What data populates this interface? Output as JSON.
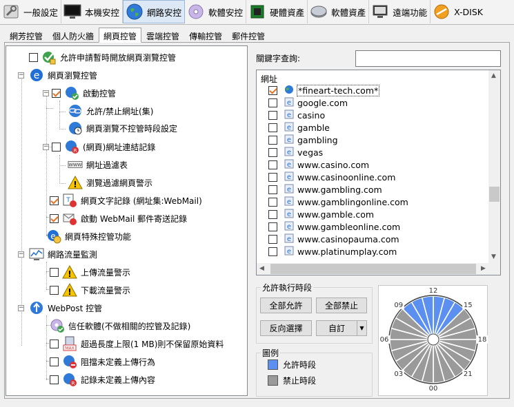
{
  "toolbar": [
    {
      "label": "一般設定",
      "icon": "wrench-icon"
    },
    {
      "label": "本機安控",
      "icon": "monitor-icon"
    },
    {
      "label": "網路安控",
      "icon": "globe-icon"
    },
    {
      "label": "軟體安控",
      "icon": "cd-icon"
    },
    {
      "label": "硬體資產",
      "icon": "chip-icon"
    },
    {
      "label": "軟體資產",
      "icon": "disc-icon"
    },
    {
      "label": "遠端功能",
      "icon": "remote-monitor-icon"
    },
    {
      "label": "X-DISK",
      "icon": "x-disk-icon"
    }
  ],
  "subtabs": [
    "網芳控管",
    "個人防火牆",
    "網頁控管",
    "雲端控管",
    "傳輸控管",
    "郵件控管"
  ],
  "tree": {
    "allow_request": "允許申請暫時開放網頁瀏覽控管",
    "web_browse": "網頁瀏覽控管",
    "enable_control": "啟動控管",
    "allow_block_urls": "允許/禁止網址(集)",
    "no_control_period": "網頁瀏覽不控管時段設定",
    "url_link_log": "(網頁)網址連結記錄",
    "url_filter_table": "網址過濾表",
    "filter_warning": "瀏覽過濾網頁警示",
    "text_log": "網頁文字記錄 (網址集:WebMail)",
    "webmail_log": "啟動 WebMail 郵件寄送記錄",
    "special_control": "網頁特殊控管功能",
    "traffic_monitor": "網路流量監測",
    "upload_warning": "上傳流量警示",
    "download_warning": "下載流量警示",
    "webpost": "WebPost 控管",
    "trusted_software": "信任軟體(不做相關的控管及記錄)",
    "size_limit": "超過長度上限(1 MB)則不保留原始資料",
    "block_undefined": "阻擋未定義上傳行為",
    "log_undefined": "記錄未定義上傳內容",
    "size_badge": "MAX"
  },
  "keyword": {
    "label": "關鍵字查詢:",
    "value": ""
  },
  "url_list": {
    "header": "網址",
    "items": [
      {
        "text": "*fineart-tech.com*",
        "checked": true,
        "selected": true
      },
      {
        "text": "google.com",
        "checked": false
      },
      {
        "text": "casino",
        "checked": false
      },
      {
        "text": "gamble",
        "checked": false
      },
      {
        "text": "gambling",
        "checked": false
      },
      {
        "text": "vegas",
        "checked": false
      },
      {
        "text": "www.casino.com",
        "checked": false
      },
      {
        "text": "www.casinoonline.com",
        "checked": false
      },
      {
        "text": "www.gambling.com",
        "checked": false
      },
      {
        "text": "www.gamblingonline.com",
        "checked": false
      },
      {
        "text": "www.gamble.com",
        "checked": false
      },
      {
        "text": "www.gambleonline.com",
        "checked": false
      },
      {
        "text": "www.casinopauma.com",
        "checked": false
      },
      {
        "text": "www.platinumplay.com",
        "checked": false
      }
    ]
  },
  "period": {
    "title": "允許執行時段",
    "allow_all": "全部允許",
    "deny_all": "全部禁止",
    "invert": "反向選擇",
    "custom": "自訂"
  },
  "legend": {
    "title": "圖例",
    "allowed": "允許時段",
    "denied": "禁止時段"
  },
  "colors": {
    "allowed": "#5b8ff0",
    "denied": "#9a9a9a",
    "check": "#e87020"
  },
  "clock": {
    "labels": [
      "12",
      "15",
      "18",
      "21",
      "00",
      "03",
      "06",
      "09"
    ],
    "allowed_sectors": [
      0,
      1,
      2,
      21,
      22,
      23
    ],
    "sectors": 24
  }
}
